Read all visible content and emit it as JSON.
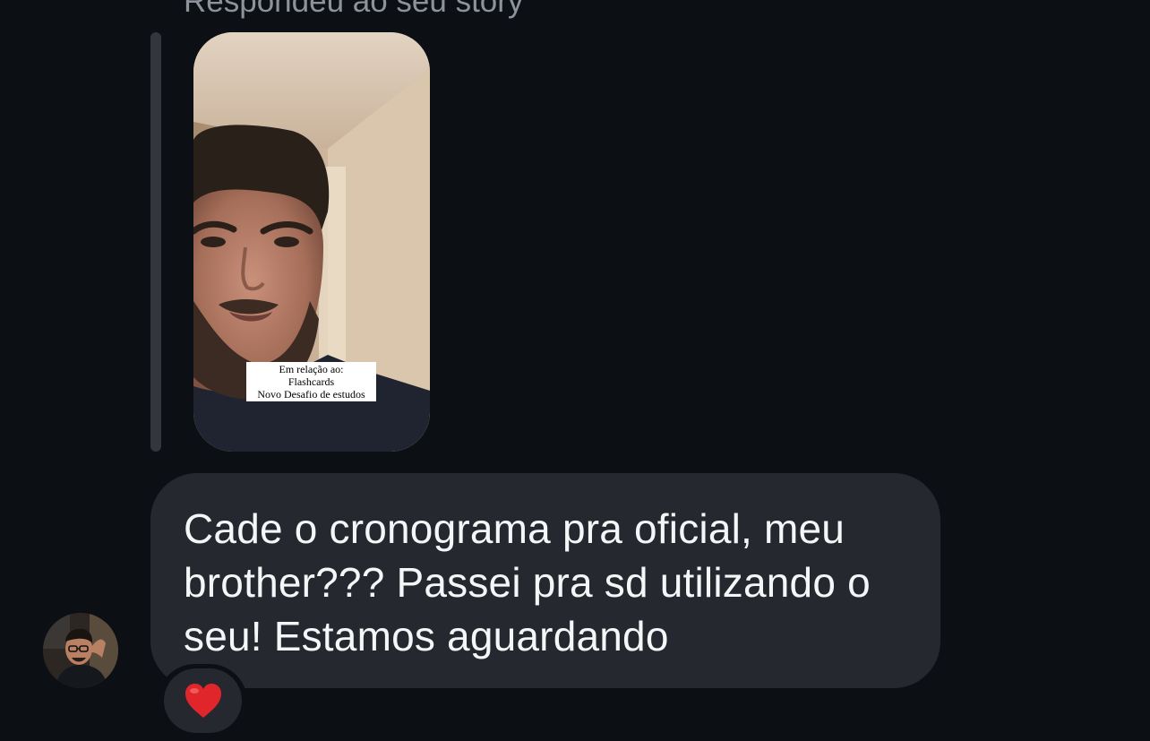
{
  "conversation": {
    "reply_context_label": "Respondeu ao seu story",
    "story": {
      "caption_lines": [
        "Em relação ao:",
        "Flashcards",
        "Novo Desafio de estudos"
      ]
    },
    "message": {
      "text": "Cade o cronograma pra oficial, meu brother??? Passei pra sd utilizando o seu! Estamos aguardando"
    },
    "reaction": {
      "icon": "red-heart-icon",
      "color": "#e0262b"
    }
  },
  "colors": {
    "background": "#0c0f14",
    "bubble": "#25282e",
    "secondary_text": "#8e939b",
    "primary_text": "#f5f6f7"
  }
}
